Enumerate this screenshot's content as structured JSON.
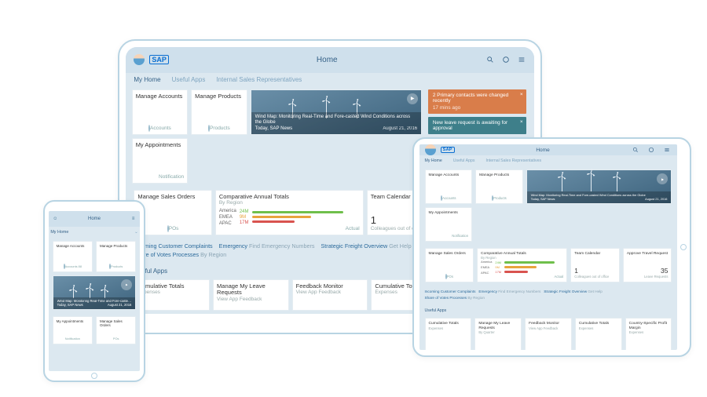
{
  "brand": "SAP",
  "topnav": {
    "title": "Home"
  },
  "tabs": {
    "my_home": "My Home",
    "useful_apps": "Useful Apps",
    "reps": "Internal Sales Representatives"
  },
  "tiles": {
    "accounts": {
      "title": "Manage Accounts",
      "foot": "Accounts"
    },
    "products": {
      "title": "Manage Products",
      "foot": "Products"
    },
    "news": {
      "headline": "Wind Map: Monitoring Real-Time and Fore-casted Wind Conditions across the Globe",
      "source": "Today, SAP News",
      "date": "August 21, 2016"
    },
    "appointments": {
      "title": "My Appointments",
      "foot": "Notification"
    },
    "orders": {
      "title": "Manage Sales Orders",
      "foot": "POs"
    },
    "comparative": {
      "title": "Comparative Annual Totals",
      "sub": "By Region",
      "legend": [
        "America",
        "EMEA",
        "APAC"
      ],
      "vals": [
        "24M",
        "9M",
        "17M"
      ],
      "foot_r": "Actual"
    },
    "calendar": {
      "title": "Team Calendar",
      "num": "1",
      "foot": "Colleagues out of office"
    },
    "travel": {
      "title": "Approve Travel Request",
      "num": "35",
      "foot": "Leave Requests"
    }
  },
  "notifs": {
    "n1": {
      "text": "2 Primary contacts were changed recently",
      "ago": "17 mins ago"
    },
    "n2": {
      "text": "New leave request is awaiting for approval"
    }
  },
  "links": {
    "l1": "Incoming Customer Complaints",
    "l2a": "Emergency",
    "l2b": "Find Emergency Numbers",
    "l3a": "Strategic Freight Overview",
    "l3b": "Get Help",
    "l4a": "Share of Votes Processes",
    "l4b": "By Region"
  },
  "section_useful": "Useful Apps",
  "utiles": {
    "u1": {
      "title": "Cumulative Totals",
      "sub": "Expenses"
    },
    "u2": {
      "title": "Manage My Leave Requests",
      "sub": "View App Feedback"
    },
    "u3": {
      "title": "Feedback Monitor",
      "sub": "View App Feedback"
    },
    "u4": {
      "title": "Cumulative Totals",
      "sub": "Expenses"
    },
    "u5": {
      "title": "Country-Specific Profit Margin",
      "sub": "Expenses"
    }
  },
  "by_quarter": "By Quarter",
  "phone_myhome": "My Home",
  "accounts_88": "Accounts 88"
}
